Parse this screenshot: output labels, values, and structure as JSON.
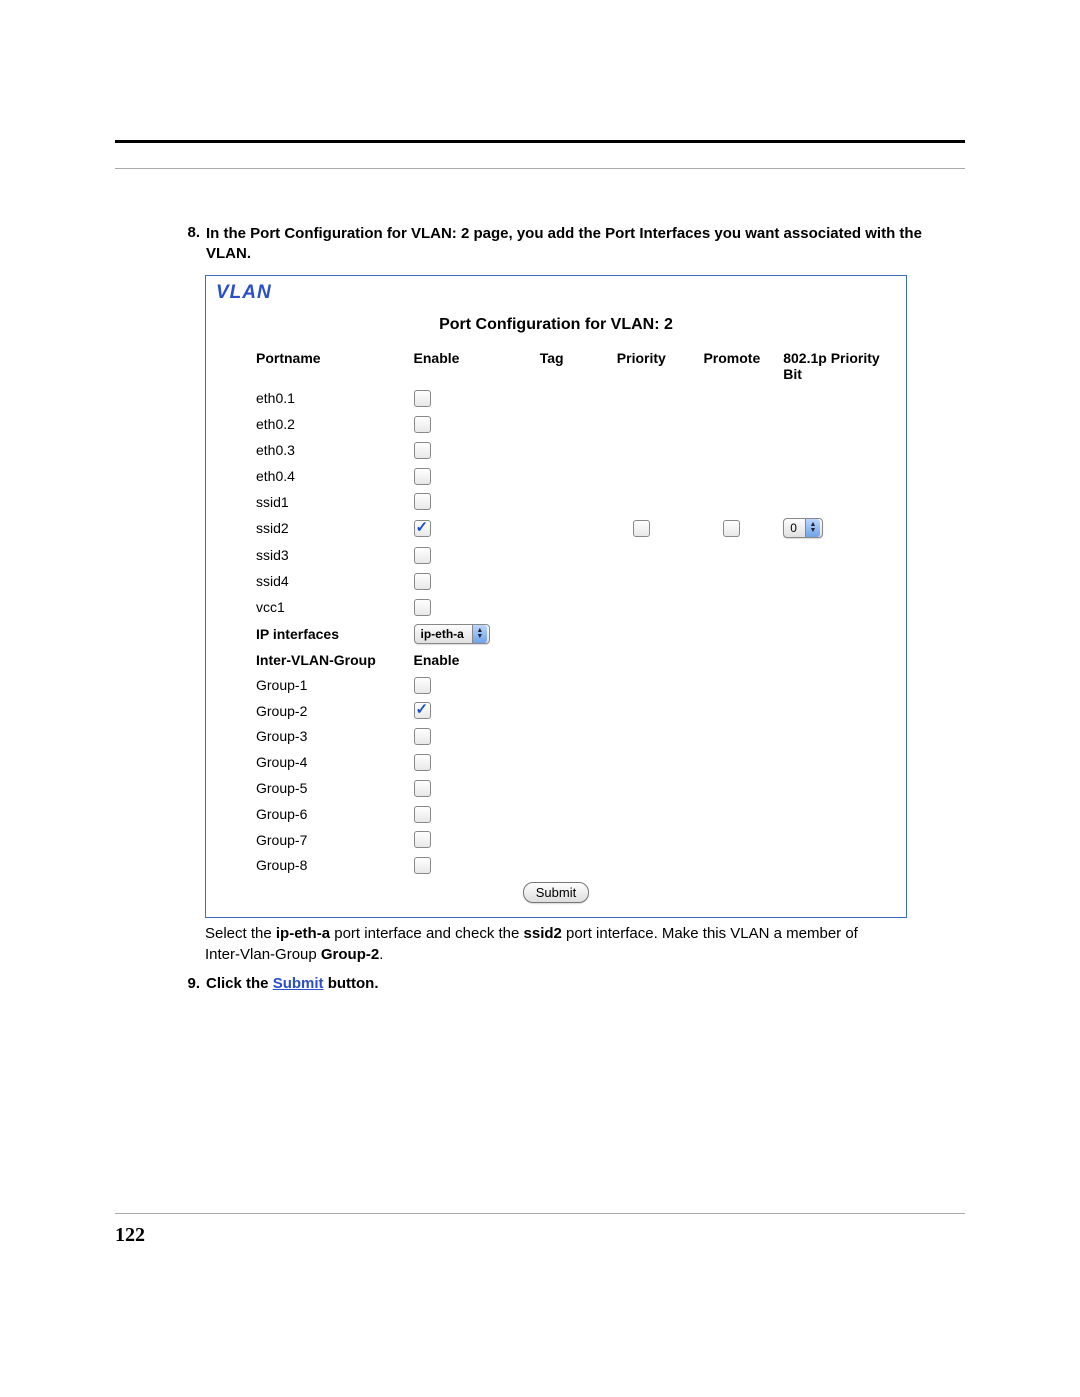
{
  "step8": {
    "number": "8.",
    "text_before": "In the Port Configuration for VLAN: 2 page, you add the Port Interfaces you want associated with the VLAN."
  },
  "panel": {
    "title": "VLAN",
    "config_title": "Port Configuration for VLAN: 2",
    "headers": {
      "portname": "Portname",
      "enable": "Enable",
      "tag": "Tag",
      "priority": "Priority",
      "promote": "Promote",
      "bit": "802.1p Priority Bit"
    },
    "ports": [
      {
        "name": "eth0.1",
        "enabled": false
      },
      {
        "name": "eth0.2",
        "enabled": false
      },
      {
        "name": "eth0.3",
        "enabled": false
      },
      {
        "name": "eth0.4",
        "enabled": false
      },
      {
        "name": "ssid1",
        "enabled": false
      },
      {
        "name": "ssid2",
        "enabled": true,
        "extra": true,
        "tag": false,
        "priority": false,
        "promote": false,
        "bit": "0"
      },
      {
        "name": "ssid3",
        "enabled": false
      },
      {
        "name": "ssid4",
        "enabled": false
      },
      {
        "name": "vcc1",
        "enabled": false
      }
    ],
    "ip_interfaces_label": "IP interfaces",
    "ip_interface_value": "ip-eth-a",
    "inter_vlan_label": "Inter-VLAN-Group",
    "inter_vlan_enable": "Enable",
    "groups": [
      {
        "name": "Group-1",
        "enabled": false
      },
      {
        "name": "Group-2",
        "enabled": true
      },
      {
        "name": "Group-3",
        "enabled": false
      },
      {
        "name": "Group-4",
        "enabled": false
      },
      {
        "name": "Group-5",
        "enabled": false
      },
      {
        "name": "Group-6",
        "enabled": false
      },
      {
        "name": "Group-7",
        "enabled": false
      },
      {
        "name": "Group-8",
        "enabled": false
      }
    ],
    "submit_label": "Submit"
  },
  "caption": {
    "p1a": "Select the ",
    "p1b": "ip-eth-a",
    "p1c": " port interface and check the ",
    "p1d": "ssid2",
    "p1e": " port interface. Make this VLAN a member of Inter-Vlan-Group ",
    "p1f": "Group-2",
    "p1g": "."
  },
  "step9": {
    "number": "9.",
    "a": "Click the ",
    "b": "Submit",
    "c": " button."
  },
  "page_number": "122"
}
